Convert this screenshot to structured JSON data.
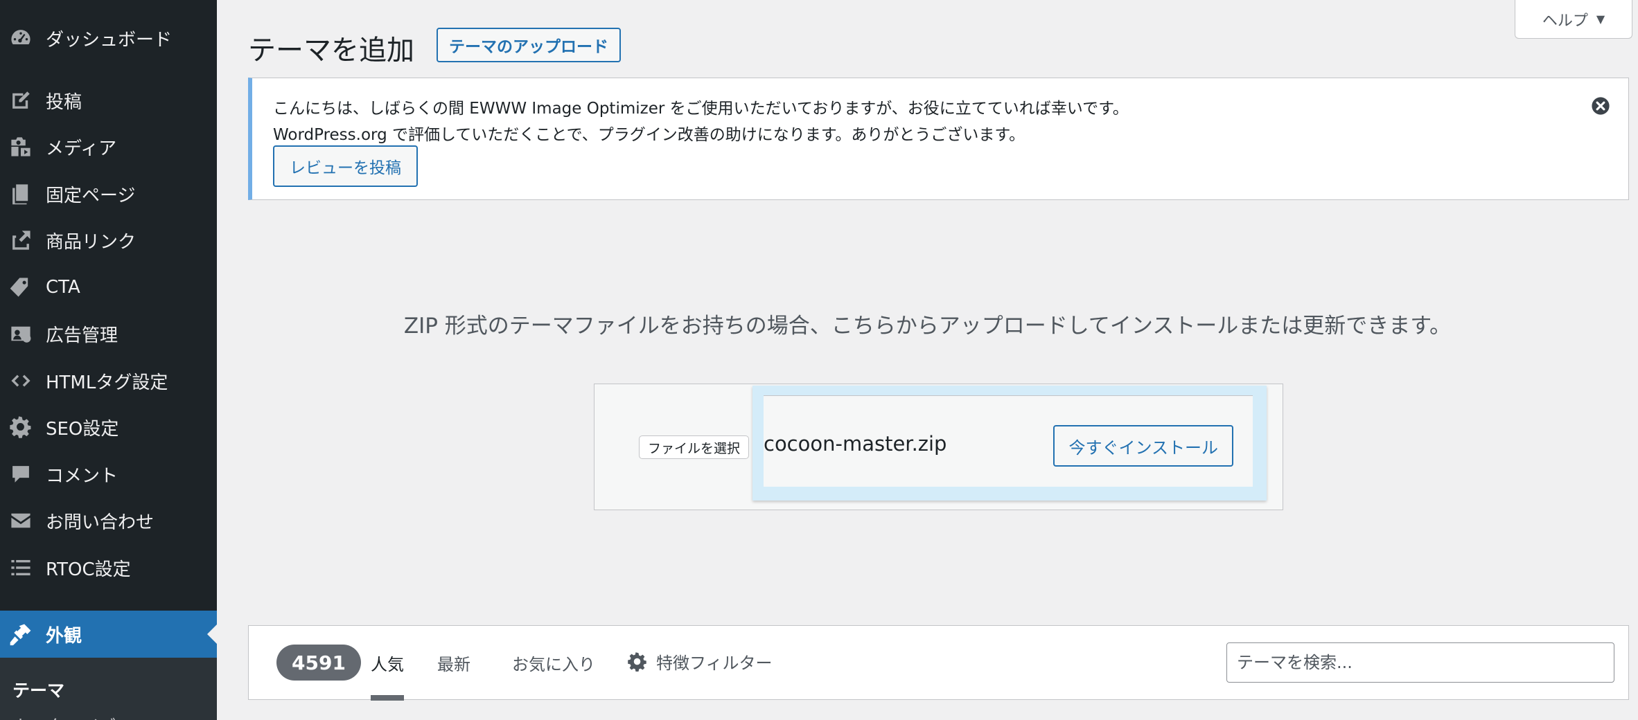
{
  "sidebar": {
    "items": [
      {
        "label": "ダッシュボード",
        "icon": "dashboard-icon"
      },
      {
        "label": "投稿",
        "icon": "post-icon"
      },
      {
        "label": "メディア",
        "icon": "media-icon"
      },
      {
        "label": "固定ページ",
        "icon": "pages-icon"
      },
      {
        "label": "商品リンク",
        "icon": "product-link-icon"
      },
      {
        "label": "CTA",
        "icon": "cta-icon"
      },
      {
        "label": "広告管理",
        "icon": "ads-icon"
      },
      {
        "label": "HTMLタグ設定",
        "icon": "code-icon"
      },
      {
        "label": "SEO設定",
        "icon": "gear-icon"
      },
      {
        "label": "コメント",
        "icon": "comment-icon"
      },
      {
        "label": "お問い合わせ",
        "icon": "mail-icon"
      },
      {
        "label": "RTOC設定",
        "icon": "list-icon"
      },
      {
        "label": "外観",
        "icon": "appearance-icon",
        "active": true
      }
    ],
    "submenu": [
      {
        "label": "テーマ"
      },
      {
        "label": "カスタマイズ"
      }
    ]
  },
  "header": {
    "help_label": "ヘルプ",
    "title": "テーマを追加",
    "upload_button": "テーマのアップロード"
  },
  "notice": {
    "line1": "こんにちは、しばらくの間 EWWW Image Optimizer をご使用いただいておりますが、お役に立てていれば幸いです。",
    "line2": "WordPress.org で評価していただくことで、プラグイン改善の助けになります。ありがとうございます。",
    "review_button": "レビューを投稿"
  },
  "upload": {
    "description": "ZIP 形式のテーマファイルをお持ちの場合、こちらからアップロードしてインストールまたは更新できます。",
    "file_button": "ファイルを選択",
    "file_name": "cocoon-master.zip",
    "install_button": "今すぐインストール"
  },
  "filter": {
    "count": "4591",
    "tabs": [
      {
        "label": "人気"
      },
      {
        "label": "最新"
      },
      {
        "label": "お気に入り"
      }
    ],
    "feature_filter": "特徴フィルター",
    "search_placeholder": "テーマを検索..."
  },
  "colors": {
    "sidebar_bg": "#1d2327",
    "accent": "#2271b1",
    "notice_border": "#72aee6"
  }
}
